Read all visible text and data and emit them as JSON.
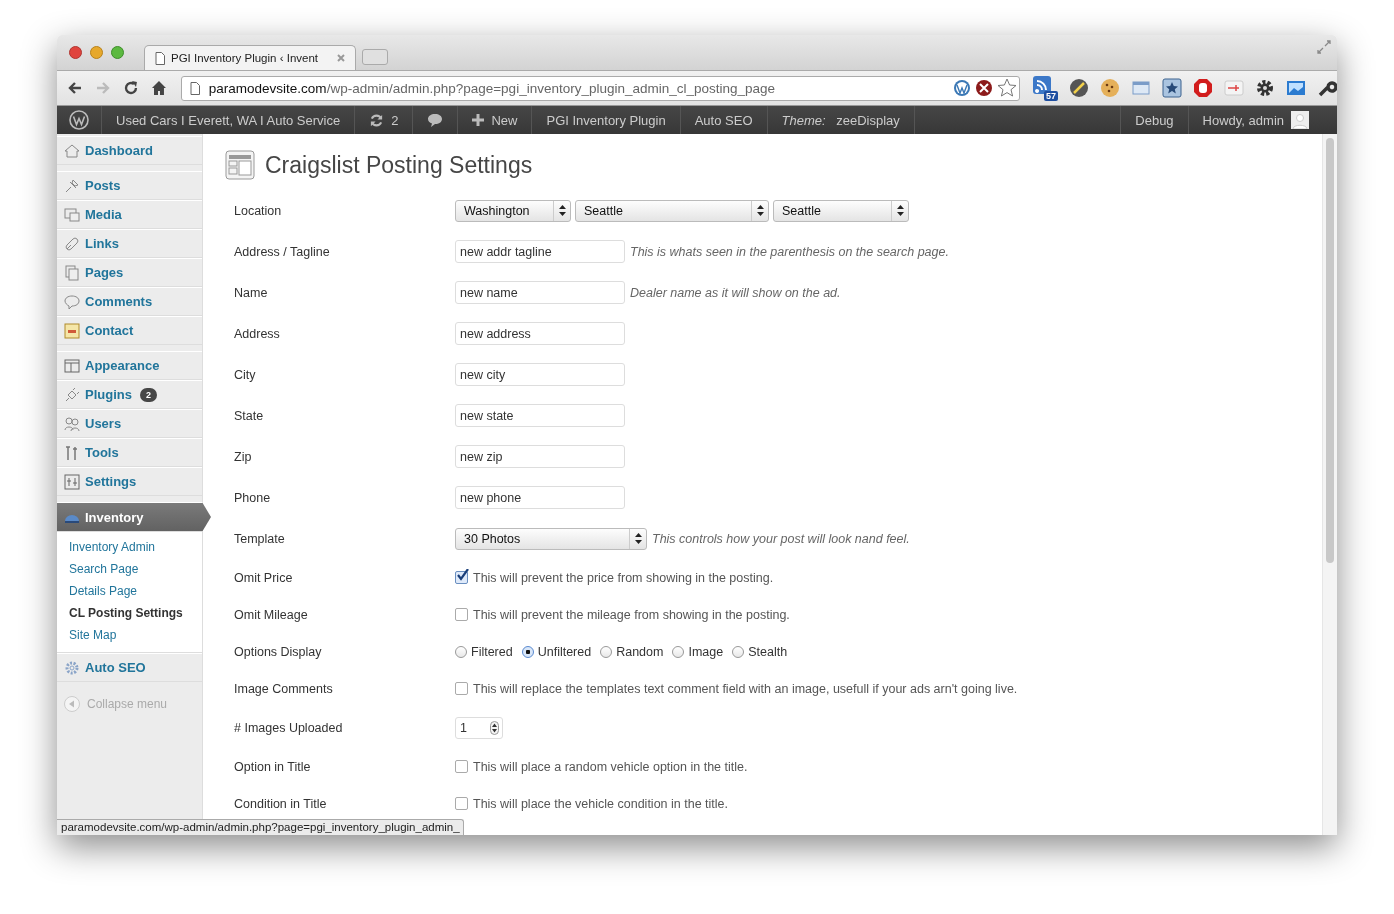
{
  "browser": {
    "tab_title": "PGI Inventory Plugin ‹ Invent",
    "url_host": "paramodevsite.com",
    "url_path": "/wp-admin/admin.php?page=pgi_inventory_plugin_admin_cl_posting_page",
    "rss_count": "57"
  },
  "admin_bar": {
    "left": [
      {
        "kind": "logo"
      },
      {
        "kind": "text",
        "label": "Used Cars I Everett, WA I Auto Service"
      },
      {
        "kind": "updates",
        "label": "2"
      },
      {
        "kind": "comments"
      },
      {
        "kind": "new",
        "label": "New"
      },
      {
        "kind": "text",
        "label": "PGI Inventory Plugin"
      },
      {
        "kind": "text",
        "label": "Auto SEO"
      },
      {
        "kind": "theme",
        "prefix": "Theme:",
        "label": "zeeDisplay"
      }
    ],
    "right": [
      {
        "kind": "text",
        "label": "Debug"
      },
      {
        "kind": "account",
        "label": "Howdy, admin"
      }
    ]
  },
  "sidebar": {
    "groups": [
      {
        "items": [
          {
            "label": "Dashboard",
            "selected": false
          }
        ]
      },
      {
        "items": [
          {
            "label": "Posts",
            "selected": false
          },
          {
            "label": "Media",
            "selected": false
          },
          {
            "label": "Links",
            "selected": false
          },
          {
            "label": "Pages",
            "selected": false
          },
          {
            "label": "Comments",
            "selected": false
          },
          {
            "label": "Contact",
            "selected": false
          }
        ]
      },
      {
        "items": [
          {
            "label": "Appearance",
            "selected": false
          },
          {
            "label": "Plugins",
            "badge": "2",
            "selected": false
          },
          {
            "label": "Users",
            "selected": false
          },
          {
            "label": "Tools",
            "selected": false
          },
          {
            "label": "Settings",
            "selected": false
          }
        ]
      },
      {
        "items": [
          {
            "label": "Inventory",
            "selected": true,
            "children": [
              {
                "label": "Inventory Admin",
                "selected": false
              },
              {
                "label": "Search Page",
                "selected": false
              },
              {
                "label": "Details Page",
                "selected": false
              },
              {
                "label": "CL Posting Settings",
                "selected": true
              },
              {
                "label": "Site Map",
                "selected": false
              }
            ]
          },
          {
            "label": "Auto SEO",
            "selected": false
          }
        ]
      }
    ],
    "collapse": "Collapse menu"
  },
  "page_title": "Craigslist Posting Settings",
  "rows": [
    {
      "kind": "selects",
      "label": "Location",
      "values": [
        "Washington",
        "Seattle",
        "Seattle"
      ]
    },
    {
      "kind": "text",
      "label": "Address / Tagline",
      "value": "new addr tagline",
      "hint": "This is whats seen in the parenthesis on the search page."
    },
    {
      "kind": "text",
      "label": "Name",
      "value": "new name",
      "hint": "Dealer name as it will show on the ad."
    },
    {
      "kind": "text",
      "label": "Address",
      "value": "new address"
    },
    {
      "kind": "text",
      "label": "City",
      "value": "new city"
    },
    {
      "kind": "text",
      "label": "State",
      "value": "new state"
    },
    {
      "kind": "text",
      "label": "Zip",
      "value": "new zip"
    },
    {
      "kind": "text",
      "label": "Phone",
      "value": "new phone"
    },
    {
      "kind": "select",
      "label": "Template",
      "value": "30 Photos",
      "hint": "This controls how your post will look nand feel."
    },
    {
      "kind": "checkbox",
      "label": "Omit Price",
      "checked": true,
      "text": "This will prevent the price from showing in the posting."
    },
    {
      "kind": "checkbox",
      "label": "Omit Mileage",
      "checked": false,
      "text": "This will prevent the mileage from showing in the posting."
    },
    {
      "kind": "radio",
      "label": "Options Display",
      "options": [
        {
          "label": "Filtered",
          "selected": false
        },
        {
          "label": "Unfiltered",
          "selected": true
        },
        {
          "label": "Random",
          "selected": false
        },
        {
          "label": "Image",
          "selected": false
        },
        {
          "label": "Stealth",
          "selected": false
        }
      ]
    },
    {
      "kind": "checkbox",
      "label": "Image Comments",
      "checked": false,
      "text": "This will replace the templates text comment field with an image, usefull if your ads arn't going live."
    },
    {
      "kind": "number",
      "label": "# Images Uploaded",
      "value": "1"
    },
    {
      "kind": "checkbox",
      "label": "Option in Title",
      "checked": false,
      "text": "This will place a random vehicle option in the title."
    },
    {
      "kind": "checkbox",
      "label": "Condition in Title",
      "checked": false,
      "text": "This will place the vehicle condition in the title."
    }
  ],
  "status_bar": "paramodevsite.com/wp-admin/admin.php?page=pgi_inventory_plugin_admin_"
}
